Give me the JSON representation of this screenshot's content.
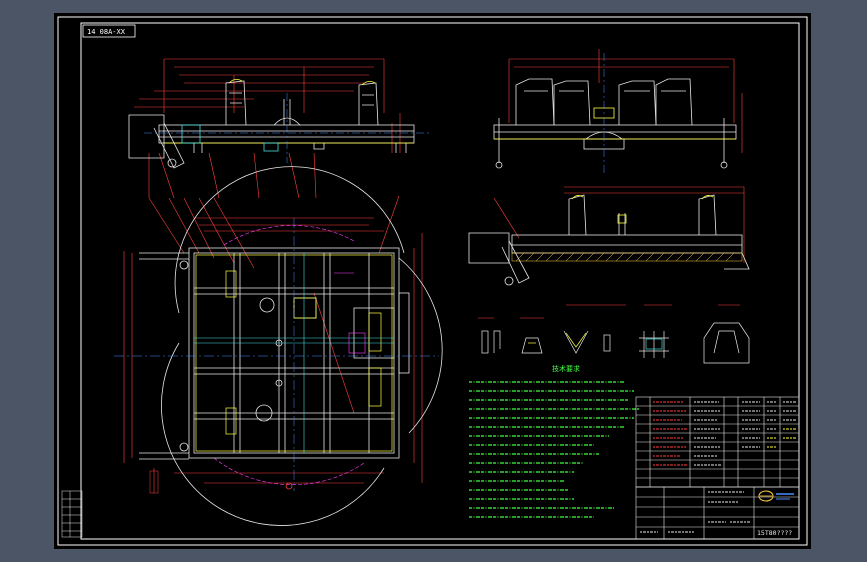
{
  "sheet": {
    "drawing_number_label": "14 08A-XX",
    "title_block": {
      "part_number": "15T80????"
    },
    "technical_requirements_title": "技术要求"
  },
  "colors": {
    "background_frame": "#4c5566",
    "sheet": "#000000",
    "border": "#ffffff",
    "structure": "#e8e8e8",
    "dimension": "#ff4040",
    "center_line": "#4a8cff",
    "weld": "#ffff40",
    "text_notes": "#40ff40",
    "hatch": "#ffd040",
    "magenta": "#ff40ff",
    "cyan": "#40e0e0"
  },
  "icons": [
    "company-logo"
  ]
}
